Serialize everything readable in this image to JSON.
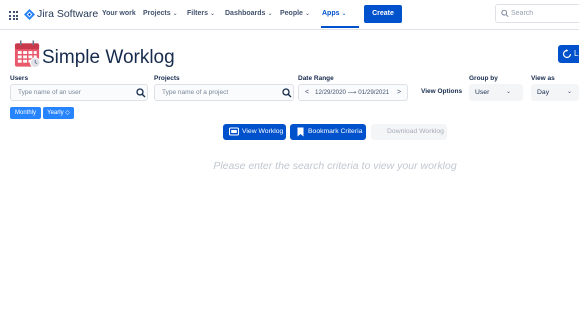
{
  "nav": {
    "product_name": "Jira Software",
    "items": [
      {
        "label": "Your work",
        "chevron": ""
      },
      {
        "label": "Projects",
        "chevron": "⌄"
      },
      {
        "label": "Filters",
        "chevron": "⌄"
      },
      {
        "label": "Dashboards",
        "chevron": "⌄"
      },
      {
        "label": "People",
        "chevron": "⌄"
      },
      {
        "label": "Apps",
        "chevron": "⌄"
      }
    ],
    "active_item": "Apps",
    "create_label": "Create",
    "search_placeholder": "Search"
  },
  "header": {
    "title": "Simple Worklog",
    "corner_button_text": "L"
  },
  "filters": {
    "users": {
      "label": "Users",
      "placeholder": "Type name of an user"
    },
    "projects": {
      "label": "Projects",
      "placeholder": "Type name of a project"
    },
    "date_range": {
      "label": "Date Range",
      "value": "12/29/2020 ⟶ 01/29/2021"
    },
    "view_options_label": "View Options",
    "group_by": {
      "label": "Group by",
      "value": "User"
    },
    "view_as": {
      "label": "View as",
      "value": "Day"
    }
  },
  "period_buttons": {
    "monthly": "Monthly",
    "yearly": "Yearly ◇"
  },
  "actions": {
    "view_worklog": "View Worklog",
    "bookmark_criteria": "Bookmark Criteria",
    "download_worklog": "Download Worklog"
  },
  "message": "Please enter the search criteria to view your worklog",
  "colors": {
    "brand": "#0052cc",
    "accent_light": "#2684ff",
    "text": "#172b4d",
    "muted": "#c1c7d0"
  }
}
